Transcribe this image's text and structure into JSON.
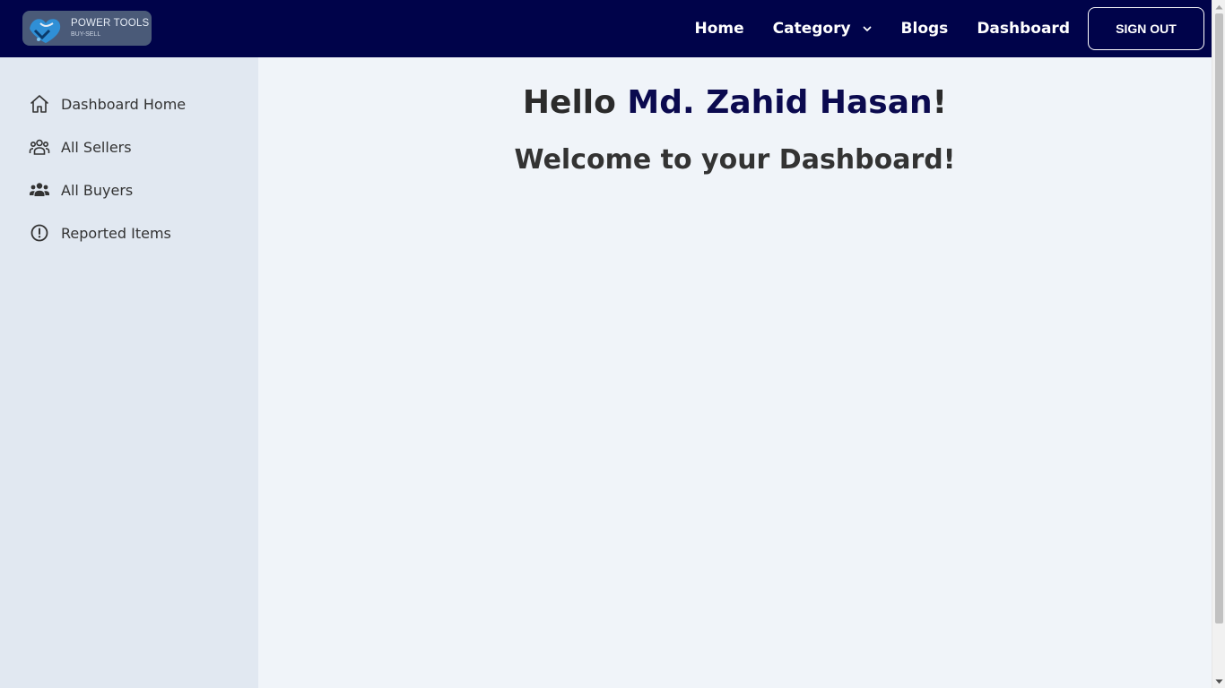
{
  "brand": {
    "title": "POWER TOOLS",
    "subtitle": "BUY-SELL"
  },
  "nav": {
    "links": [
      "Home",
      "Category",
      "Blogs",
      "Dashboard"
    ],
    "signout_label": "SIGN OUT"
  },
  "sidebar": {
    "items": [
      {
        "label": "Dashboard Home",
        "icon": "home-icon"
      },
      {
        "label": "All Sellers",
        "icon": "users-icon"
      },
      {
        "label": "All Buyers",
        "icon": "users-solid-icon"
      },
      {
        "label": "Reported Items",
        "icon": "alert-icon"
      }
    ]
  },
  "main": {
    "greeting_prefix": "Hello ",
    "user_name": "Md. Zahid Hasan",
    "greeting_suffix": "!",
    "welcome": "Welcome to your Dashboard!"
  },
  "colors": {
    "navbar": "#00034a",
    "sidebar": "#e1e8f1",
    "main_bg": "#f0f4f9",
    "user_name": "#0b0a4f"
  }
}
